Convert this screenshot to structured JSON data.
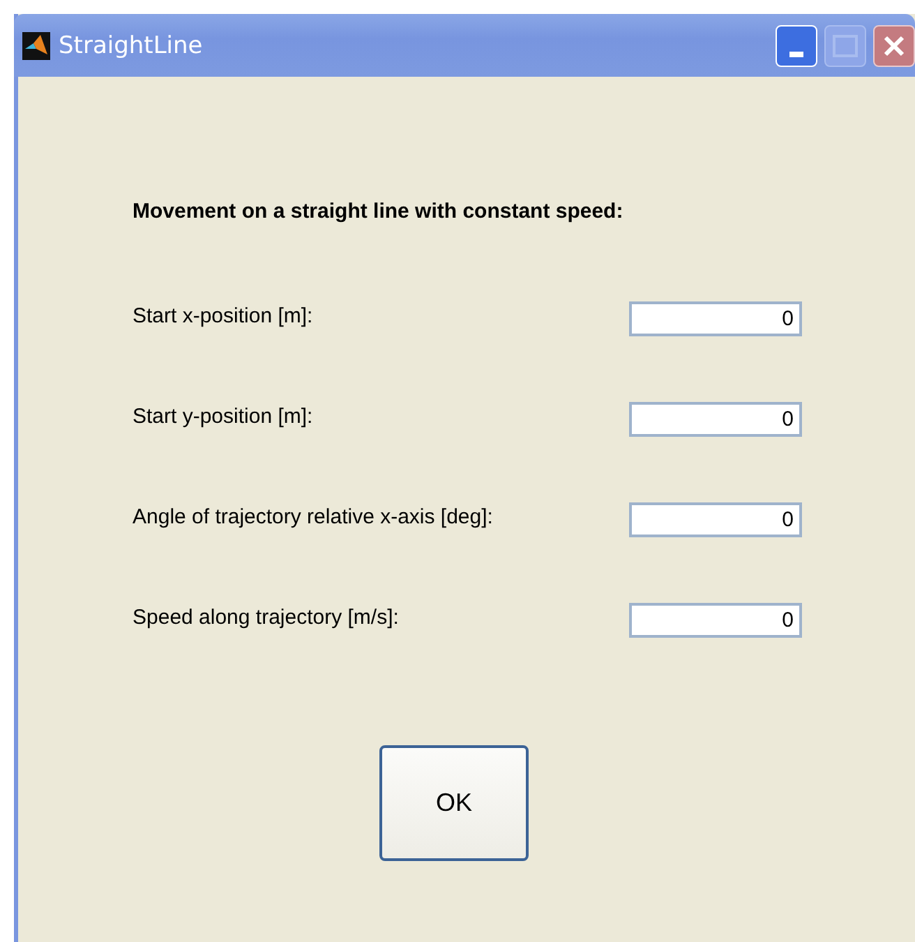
{
  "window": {
    "title": "StraightLine"
  },
  "heading": "Movement on a straight line with constant speed:",
  "fields": [
    {
      "label": "Start x-position [m]:",
      "value": "0"
    },
    {
      "label": "Start y-position [m]:",
      "value": "0"
    },
    {
      "label": "Angle of trajectory relative x-axis [deg]:",
      "value": "0"
    },
    {
      "label": "Speed along trajectory [m/s]:",
      "value": "0"
    }
  ],
  "buttons": [
    "OK"
  ]
}
